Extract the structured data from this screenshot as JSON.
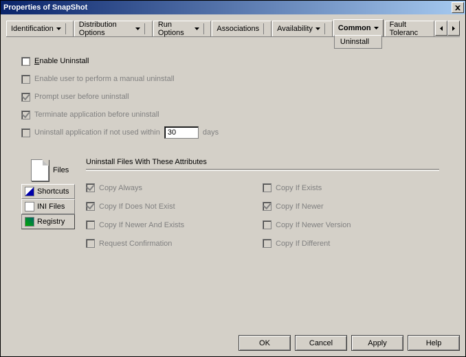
{
  "window": {
    "title": "Properties of SnapShot"
  },
  "tabs": {
    "identification": "Identification",
    "distribution": "Distribution Options",
    "run": "Run Options",
    "associations": "Associations",
    "availability": "Availability",
    "common": "Common",
    "fault": "Fault Toleranc",
    "dropdown_item": "Uninstall"
  },
  "options": {
    "enable_uninstall": "Enable Uninstall",
    "enable_manual": "Enable user to perform a manual uninstall",
    "prompt_before": "Prompt user before uninstall",
    "terminate_before": "Terminate application before uninstall",
    "uninstall_if_unused": "Uninstall application if not used within",
    "days_value": "30",
    "days_suffix": "days"
  },
  "side": {
    "files": "Files",
    "shortcuts": "Shortcuts",
    "ini": "INI Files",
    "registry": "Registry"
  },
  "attrs": {
    "title": "Uninstall Files With These Attributes",
    "copy_always": "Copy Always",
    "copy_if_exists": "Copy If Exists",
    "copy_if_not_exist": "Copy If Does Not Exist",
    "copy_if_newer": "Copy If Newer",
    "copy_if_newer_exists": "Copy If Newer And Exists",
    "copy_if_newer_version": "Copy If Newer Version",
    "request_confirmation": "Request Confirmation",
    "copy_if_different": "Copy If Different"
  },
  "buttons": {
    "ok": "OK",
    "cancel": "Cancel",
    "apply": "Apply",
    "help": "Help"
  }
}
